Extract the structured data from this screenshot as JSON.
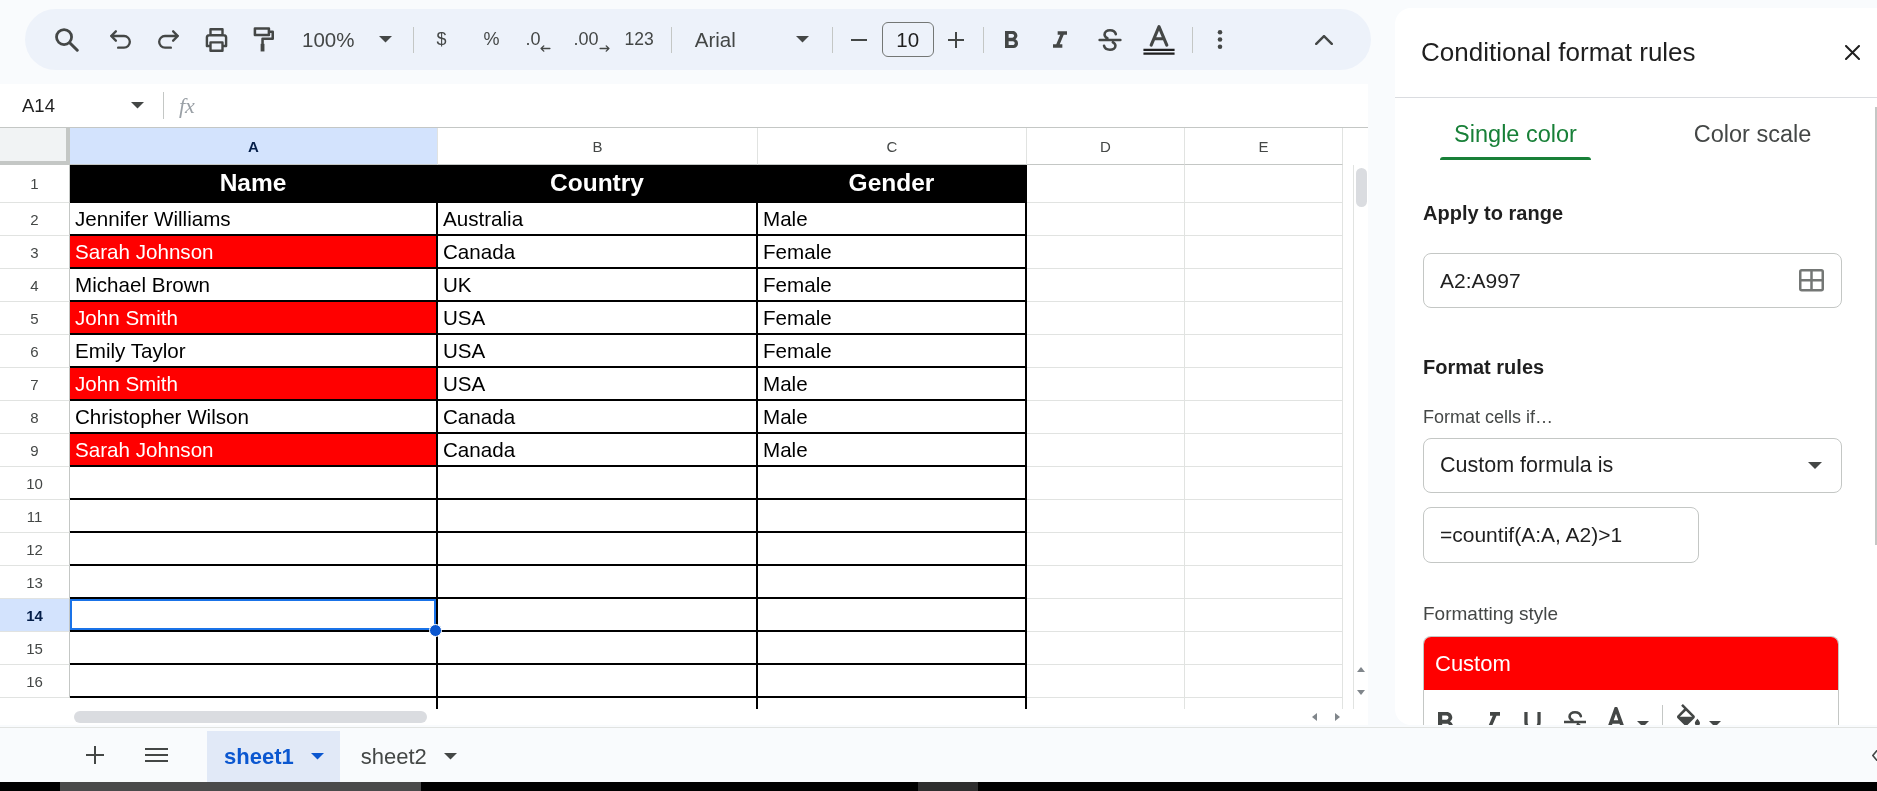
{
  "toolbar": {
    "zoom": "100%",
    "currency": "$",
    "percent": "%",
    "decrease_decimal": ".0",
    "increase_decimal": ".00",
    "more_formats": "123",
    "font": "Arial",
    "font_size": "10"
  },
  "formula_bar": {
    "cell_reference": "A14",
    "function_label": "fx"
  },
  "sheet": {
    "columns": [
      {
        "label": "A",
        "selected": true
      },
      {
        "label": "B",
        "selected": false
      },
      {
        "label": "C",
        "selected": false
      },
      {
        "label": "D",
        "selected": false
      },
      {
        "label": "E",
        "selected": false
      }
    ],
    "rows": [
      {
        "number": "1",
        "selected": false,
        "kind": "header",
        "cells": [
          {
            "text": "Name"
          },
          {
            "text": "Country"
          },
          {
            "text": "Gender"
          }
        ]
      },
      {
        "number": "2",
        "selected": false,
        "kind": "data",
        "cells": [
          {
            "text": "Jennifer Williams",
            "highlighted": false
          },
          {
            "text": "Australia",
            "highlighted": false
          },
          {
            "text": "Male",
            "highlighted": false
          }
        ]
      },
      {
        "number": "3",
        "selected": false,
        "kind": "data",
        "cells": [
          {
            "text": "Sarah Johnson",
            "highlighted": true
          },
          {
            "text": "Canada",
            "highlighted": false
          },
          {
            "text": "Female",
            "highlighted": false
          }
        ]
      },
      {
        "number": "4",
        "selected": false,
        "kind": "data",
        "cells": [
          {
            "text": "Michael Brown",
            "highlighted": false
          },
          {
            "text": "UK",
            "highlighted": false
          },
          {
            "text": "Female",
            "highlighted": false
          }
        ]
      },
      {
        "number": "5",
        "selected": false,
        "kind": "data",
        "cells": [
          {
            "text": "John Smith",
            "highlighted": true
          },
          {
            "text": "USA",
            "highlighted": false
          },
          {
            "text": "Female",
            "highlighted": false
          }
        ]
      },
      {
        "number": "6",
        "selected": false,
        "kind": "data",
        "cells": [
          {
            "text": "Emily Taylor",
            "highlighted": false
          },
          {
            "text": "USA",
            "highlighted": false
          },
          {
            "text": "Female",
            "highlighted": false
          }
        ]
      },
      {
        "number": "7",
        "selected": false,
        "kind": "data",
        "cells": [
          {
            "text": "John Smith",
            "highlighted": true
          },
          {
            "text": "USA",
            "highlighted": false
          },
          {
            "text": "Male",
            "highlighted": false
          }
        ]
      },
      {
        "number": "8",
        "selected": false,
        "kind": "data",
        "cells": [
          {
            "text": "Christopher Wilson",
            "highlighted": false
          },
          {
            "text": "Canada",
            "highlighted": false
          },
          {
            "text": "Male",
            "highlighted": false
          }
        ]
      },
      {
        "number": "9",
        "selected": false,
        "kind": "data",
        "cells": [
          {
            "text": "Sarah Johnson",
            "highlighted": true
          },
          {
            "text": "Canada",
            "highlighted": false
          },
          {
            "text": "Male",
            "highlighted": false
          }
        ]
      },
      {
        "number": "10",
        "selected": false,
        "kind": "data"
      },
      {
        "number": "11",
        "selected": false,
        "kind": "data"
      },
      {
        "number": "12",
        "selected": false,
        "kind": "data"
      },
      {
        "number": "13",
        "selected": false,
        "kind": "data"
      },
      {
        "number": "14",
        "selected": true,
        "kind": "data"
      },
      {
        "number": "15",
        "selected": false,
        "kind": "data"
      },
      {
        "number": "16",
        "selected": false,
        "kind": "data"
      }
    ]
  },
  "sheet_tabs": [
    {
      "name": "sheet1",
      "selected": true
    },
    {
      "name": "sheet2",
      "selected": false
    }
  ],
  "panel": {
    "title": "Conditional format rules",
    "tabs": [
      {
        "label": "Single color",
        "selected": true
      },
      {
        "label": "Color scale",
        "selected": false
      }
    ],
    "range_label": "Apply to range",
    "range": "A2:A997",
    "rules_heading": "Format rules",
    "condition_label": "Format cells if…",
    "condition": "Custom formula is",
    "formula": "=countif(A:A, A2)>1",
    "style_label": "Formatting style",
    "style_preset": "Custom"
  }
}
